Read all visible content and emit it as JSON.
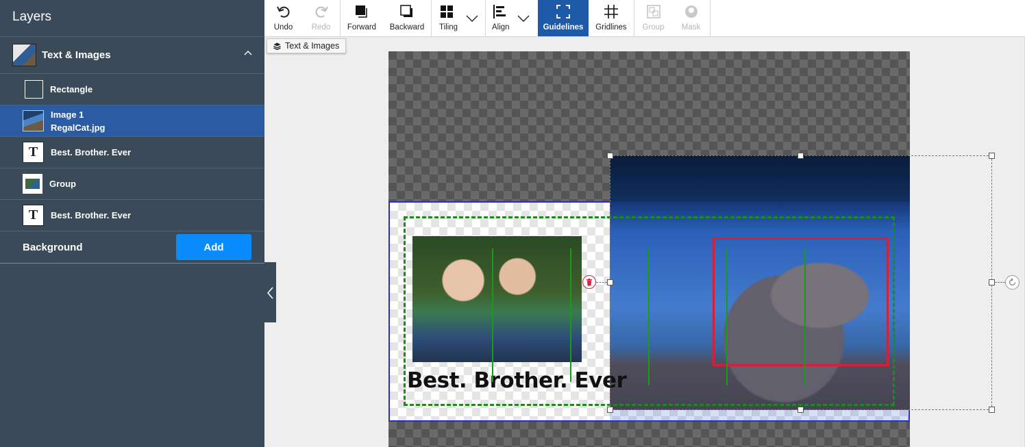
{
  "sidebar": {
    "title": "Layers",
    "group": {
      "label": "Text & Images"
    },
    "layers": [
      {
        "label": "Rectangle",
        "sublabel": "",
        "icon": "rectangle-icon"
      },
      {
        "label": "Image 1",
        "sublabel": "RegalCat.jpg",
        "icon": "image-thumbnail"
      },
      {
        "label": "Best. Brother. Ever",
        "sublabel": "",
        "icon": "text-icon"
      },
      {
        "label": "Group",
        "sublabel": "",
        "icon": "group-thumbnail"
      },
      {
        "label": "Best. Brother. Ever",
        "sublabel": "",
        "icon": "text-icon"
      }
    ],
    "background": {
      "label": "Background",
      "add_label": "Add"
    },
    "text_icon_glyph": "T"
  },
  "toolbar": {
    "undo": "Undo",
    "redo": "Redo",
    "forward": "Forward",
    "backward": "Backward",
    "tiling": "Tiling",
    "align": "Align",
    "guidelines": "Guidelines",
    "gridlines": "Gridlines",
    "group": "Group",
    "mask": "Mask"
  },
  "canvas": {
    "breadcrumb": "Text & Images",
    "card_text": "Best. Brother. Ever"
  },
  "colors": {
    "sidebar_bg": "#3b4a59",
    "selected_row": "#2b5ba3",
    "accent_button": "#0a8cff",
    "active_tool": "#1f5aa8",
    "guide_green": "#1d8a1d",
    "guide_red": "#d6203a",
    "selection_blue": "#2a2ad4"
  }
}
